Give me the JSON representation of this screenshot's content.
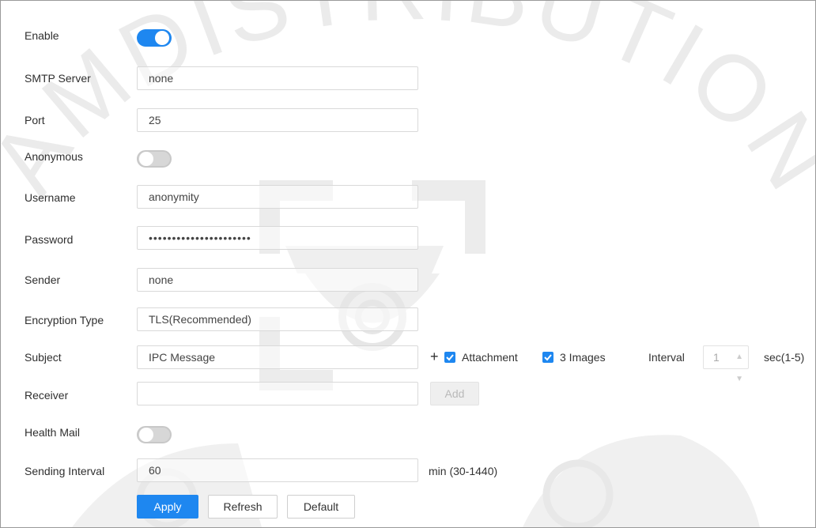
{
  "form": {
    "enable": {
      "label": "Enable",
      "on": true
    },
    "smtp_server": {
      "label": "SMTP Server",
      "value": "none"
    },
    "port": {
      "label": "Port",
      "value": "25"
    },
    "anonymous": {
      "label": "Anonymous",
      "on": false
    },
    "username": {
      "label": "Username",
      "value": "anonymity"
    },
    "password": {
      "label": "Password",
      "value": "••••••••••••••••••••••"
    },
    "sender": {
      "label": "Sender",
      "value": "none"
    },
    "encryption_type": {
      "label": "Encryption Type",
      "value": "TLS(Recommended)"
    },
    "subject": {
      "label": "Subject",
      "value": "IPC Message",
      "plus": "+",
      "attachment_label": "Attachment",
      "attachment_checked": true,
      "images_label": "3 Images",
      "images_checked": true,
      "interval_label": "Interval",
      "interval_value": "1",
      "interval_unit": "sec(1-5)"
    },
    "receiver": {
      "label": "Receiver",
      "value": "",
      "add_label": "Add"
    },
    "health_mail": {
      "label": "Health Mail",
      "on": false
    },
    "sending_interval": {
      "label": "Sending Interval",
      "value": "60",
      "unit": "min (30-1440)"
    }
  },
  "buttons": {
    "apply": "Apply",
    "refresh": "Refresh",
    "default": "Default"
  },
  "colors": {
    "accent": "#1e87f0",
    "toggle_off": "#d7d7d7",
    "border": "#d9d9d9"
  },
  "watermark": {
    "text": "AMDISTRIBUTION"
  }
}
